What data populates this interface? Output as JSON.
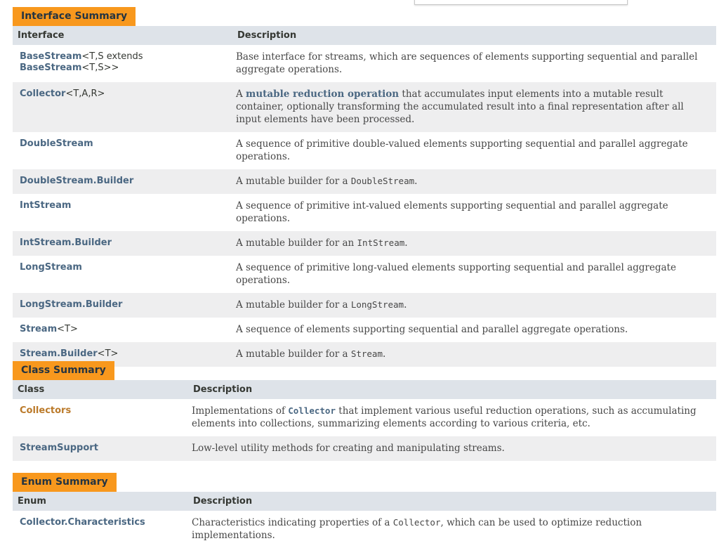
{
  "interface_summary": {
    "caption": "Interface Summary",
    "col1": "Interface",
    "col2": "Description",
    "rows": [
      {
        "name": "BaseStream",
        "params_a": "<T,S extends ",
        "name2": "BaseStream",
        "params_b": "<T,S>>",
        "desc": "Base interface for streams, which are sequences of elements supporting sequential and parallel aggregate operations."
      },
      {
        "name": "Collector",
        "params": "<T,A,R>",
        "desc_pre": "A ",
        "desc_link": "mutable reduction operation",
        "desc_post": " that accumulates input elements into a mutable result container, optionally transforming the accumulated result into a final representation after all input elements have been processed."
      },
      {
        "name": "DoubleStream",
        "desc": "A sequence of primitive double-valued elements supporting sequential and parallel aggregate operations."
      },
      {
        "name": "DoubleStream.Builder",
        "desc_pre": "A mutable builder for a ",
        "desc_code": "DoubleStream",
        "desc_post": "."
      },
      {
        "name": "IntStream",
        "desc": "A sequence of primitive int-valued elements supporting sequential and parallel aggregate operations."
      },
      {
        "name": "IntStream.Builder",
        "desc_pre": "A mutable builder for an ",
        "desc_code": "IntStream",
        "desc_post": "."
      },
      {
        "name": "LongStream",
        "desc": "A sequence of primitive long-valued elements supporting sequential and parallel aggregate operations."
      },
      {
        "name": "LongStream.Builder",
        "desc_pre": "A mutable builder for a ",
        "desc_code": "LongStream",
        "desc_post": "."
      },
      {
        "name": "Stream",
        "params": "<T>",
        "desc": "A sequence of elements supporting sequential and parallel aggregate operations."
      },
      {
        "name": "Stream.Builder",
        "params": "<T>",
        "desc_pre": "A mutable builder for a ",
        "desc_code": "Stream",
        "desc_post": "."
      }
    ]
  },
  "class_summary": {
    "caption": "Class Summary",
    "col1": "Class",
    "col2": "Description",
    "rows": [
      {
        "name": "Collectors",
        "desc_pre": "Implementations of ",
        "desc_link": "Collector",
        "desc_post": " that implement various useful reduction operations, such as accumulating elements into collections, summarizing elements according to various criteria, etc."
      },
      {
        "name": "StreamSupport",
        "desc": "Low-level utility methods for creating and manipulating streams."
      }
    ]
  },
  "enum_summary": {
    "caption": "Enum Summary",
    "col1": "Enum",
    "col2": "Description",
    "rows": [
      {
        "name": "Collector.Characteristics",
        "desc_pre": "Characteristics indicating properties of a ",
        "desc_code": "Collector",
        "desc_post": ", which can be used to optimize reduction implementations."
      }
    ]
  },
  "colors": {
    "caption_bg": "#f8981d",
    "header_bg": "#dee3e9",
    "alt_row_bg": "#eeeeef",
    "link": "#4a6782",
    "visited_link": "#bb7a2a"
  }
}
